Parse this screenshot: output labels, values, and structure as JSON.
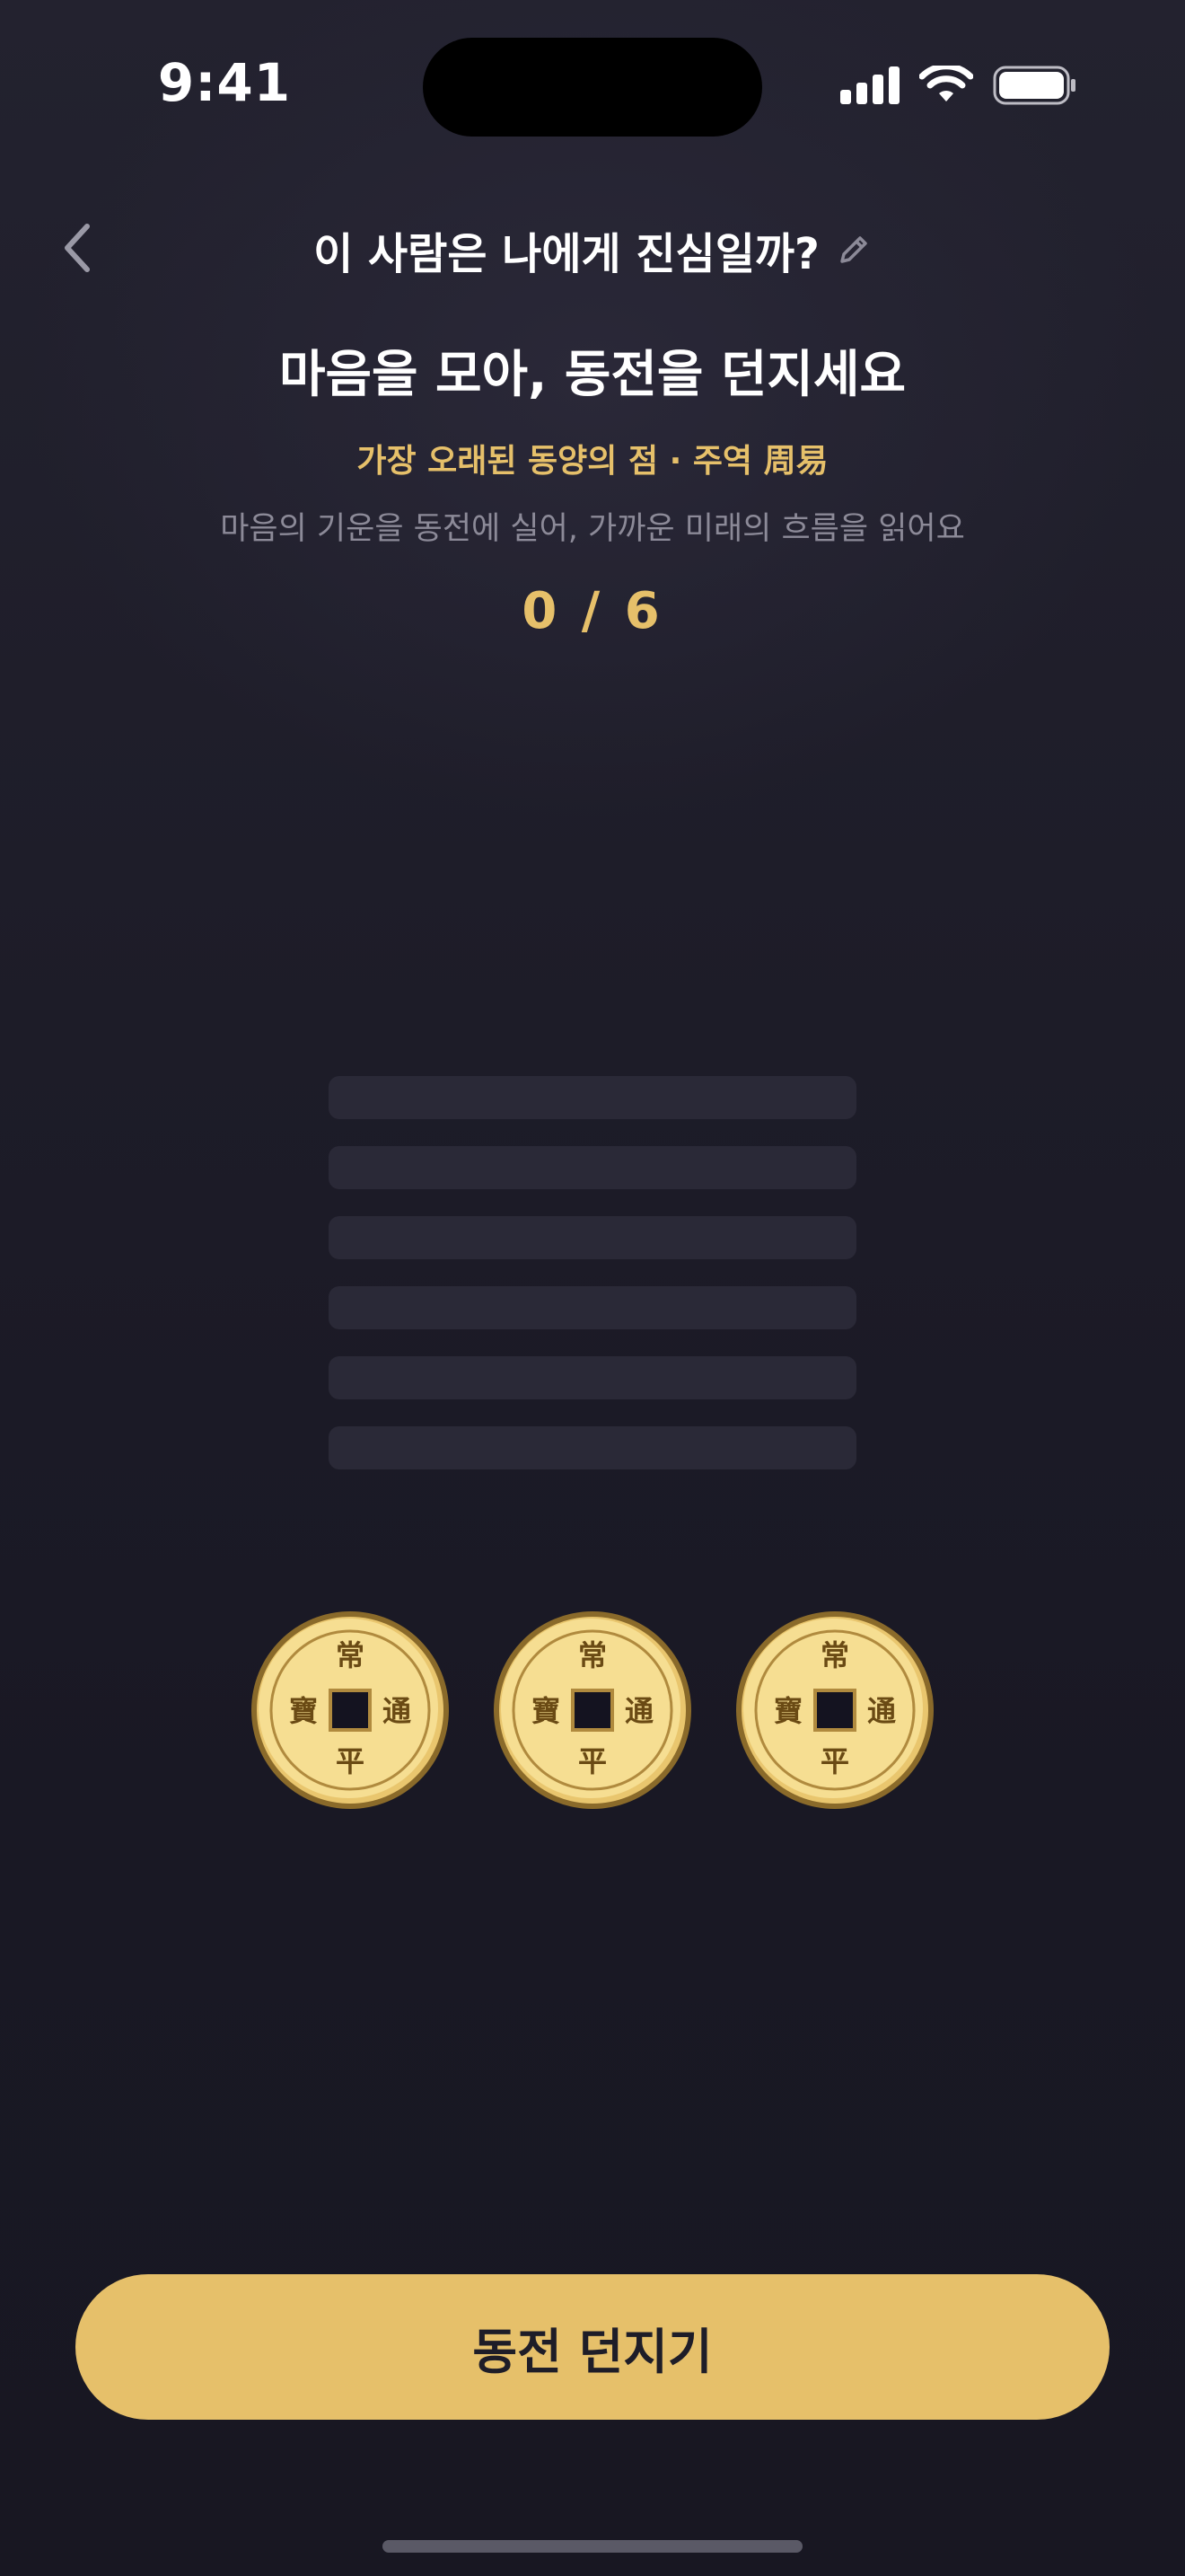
{
  "status_bar": {
    "time": "9:41"
  },
  "header": {
    "back_icon": "chevron-left-icon",
    "title": "이 사람은 나에게 진심일까?",
    "edit_icon": "pencil-icon"
  },
  "intro": {
    "heading": "마음을 모아, 동전을 던지세요",
    "subheading": "가장 오래된 동양의 점 · 주역 周易",
    "description": "마음의 기운을 동전에 실어, 가까운 미래의 흐름을 읽어요",
    "progress": "0 / 6",
    "lines_cast": 0,
    "lines_total": 6
  },
  "coins": [
    {
      "top": "常",
      "right": "通",
      "bottom": "平",
      "left": "寶"
    },
    {
      "top": "常",
      "right": "通",
      "bottom": "平",
      "left": "寶"
    },
    {
      "top": "常",
      "right": "通",
      "bottom": "平",
      "left": "寶"
    }
  ],
  "cta": {
    "label": "동전 던지기"
  },
  "colors": {
    "background": "#1d1c28",
    "accent_gold": "#e6c06a",
    "muted_text": "#8c8a98",
    "placeholder_line": "#2a2937",
    "coin_face": "#f5dc8f",
    "coin_text": "#6a4a14"
  }
}
